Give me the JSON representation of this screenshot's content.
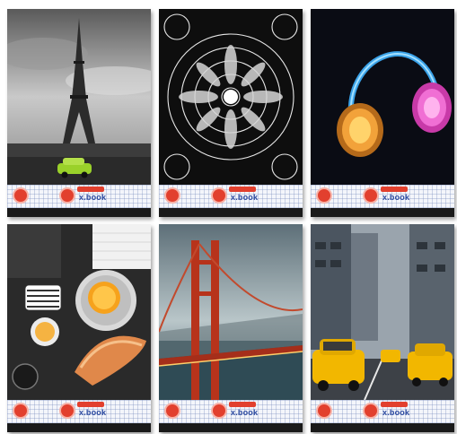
{
  "covers": [
    {
      "brand": "x.book",
      "subject": "Eiffel Tower with green car, black and white"
    },
    {
      "brand": "x.book",
      "subject": "Black and white mandala pattern"
    },
    {
      "brand": "x.book",
      "subject": "Neon headphones on dark background"
    },
    {
      "brand": "x.book",
      "subject": "Breakfast table with orange, cups and croissant"
    },
    {
      "brand": "x.book",
      "subject": "Golden Gate Bridge at dusk"
    },
    {
      "brand": "x.book",
      "subject": "Yellow taxi cabs on New York street"
    }
  ],
  "colors": {
    "accent_red": "#e2402e",
    "brand_blue": "#2c4aa0",
    "grid_paper": "#f4f6fb"
  }
}
